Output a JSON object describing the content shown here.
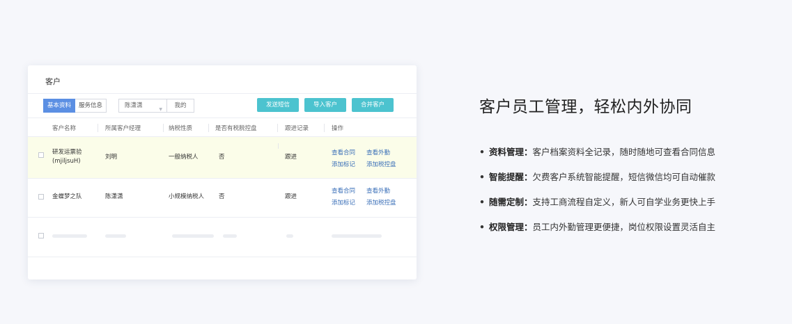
{
  "card": {
    "title": "客户",
    "segment": [
      "基本资料",
      "服务信息"
    ],
    "select_value": "陈潇潇",
    "mine_label": "我的",
    "buttons": [
      "发送短信",
      "导入客户",
      "合并客户"
    ],
    "columns": [
      "客户名称",
      "所属客户经理",
      "纳税性质",
      "是否有税脱控盘",
      "跟进记录",
      "操作"
    ],
    "rows": [
      {
        "name": "研发运票验",
        "name_sub": "(mjiljsuH)",
        "manager": "刘明",
        "tax_type": "一般纳税人",
        "has_tax_disk": "否",
        "followup": "跟进",
        "actions": [
          "查看合同",
          "查看外勤",
          "添加标记",
          "添加税控盘"
        ]
      },
      {
        "name": "金蝶梦之队",
        "name_sub": "",
        "manager": "陈潇潇",
        "tax_type": "小规模纳税人",
        "has_tax_disk": "否",
        "followup": "跟进",
        "actions": [
          "查看合同",
          "查看外勤",
          "添加标记",
          "添加税控盘"
        ]
      }
    ]
  },
  "heading": "客户员工管理，轻松内外协同",
  "features": [
    {
      "key": "资料管理：",
      "text": "客户档案资料全记录，随时随地可查看合同信息"
    },
    {
      "key": "智能提醒：",
      "text": "欠费客户系统智能提醒，短信微信均可自动催款"
    },
    {
      "key": "随需定制：",
      "text": "支持工商流程自定义，新人可自学业务更快上手"
    },
    {
      "key": "权限管理：",
      "text": "员工内外勤管理更便捷，岗位权限设置灵活自主"
    }
  ],
  "colors": {
    "accent": "#4cc3cf",
    "segment_active": "#5b8fe3",
    "link": "#3a6fb8",
    "highlight_row": "#fbfde9"
  }
}
